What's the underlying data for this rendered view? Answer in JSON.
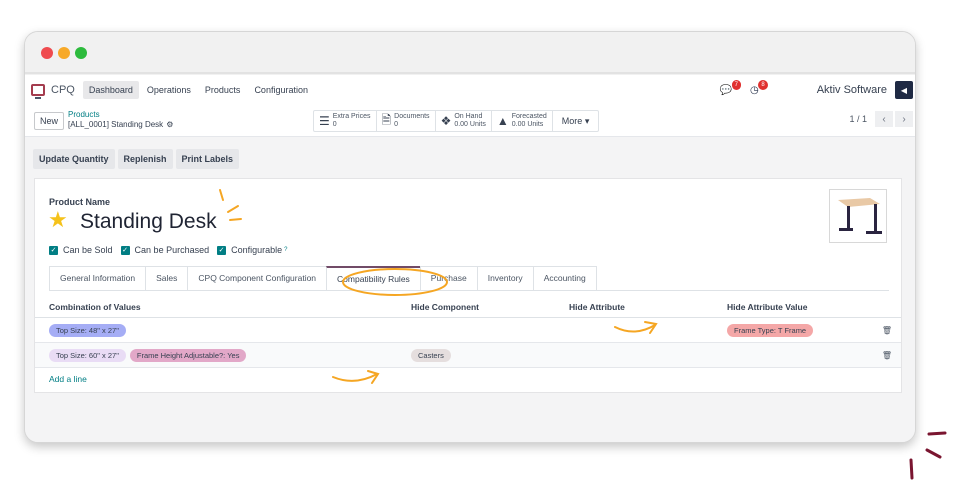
{
  "window": {
    "controls": [
      "close",
      "minimize",
      "maximize"
    ]
  },
  "navbar": {
    "app_name": "CPQ",
    "menu": [
      {
        "label": "Dashboard",
        "active": true
      },
      {
        "label": "Operations",
        "active": false
      },
      {
        "label": "Products",
        "active": false
      },
      {
        "label": "Configuration",
        "active": false
      }
    ],
    "messages_badge": "7",
    "activities_badge": "8",
    "company": "Aktiv Software",
    "avatar_icon": "exit-icon"
  },
  "control": {
    "new_label": "New",
    "breadcrumb_parent": "Products",
    "breadcrumb_current": "[ALL_0001] Standing Desk",
    "smart_buttons": [
      {
        "icon": "list-icon",
        "title": "Extra Prices",
        "value": "0"
      },
      {
        "icon": "document-icon",
        "title": "Documents",
        "value": "0"
      },
      {
        "icon": "cubes-icon",
        "title": "On Hand",
        "value": "0.00 Units"
      },
      {
        "icon": "area-chart-icon",
        "title": "Forecasted",
        "value": "0.00 Units"
      }
    ],
    "more_label": "More",
    "pager": "1 / 1"
  },
  "actions": [
    "Update Quantity",
    "Replenish",
    "Print Labels"
  ],
  "product": {
    "name_label": "Product Name",
    "name": "Standing Desk",
    "favorite": true,
    "checks": [
      {
        "label": "Can be Sold",
        "checked": true
      },
      {
        "label": "Can be Purchased",
        "checked": true
      },
      {
        "label": "Configurable",
        "checked": true,
        "help": "?"
      }
    ]
  },
  "tabs": [
    {
      "label": "General Information",
      "active": false
    },
    {
      "label": "Sales",
      "active": false
    },
    {
      "label": "CPQ Component Configuration",
      "active": false
    },
    {
      "label": "Compatibility Rules",
      "active": true
    },
    {
      "label": "Purchase",
      "active": false
    },
    {
      "label": "Inventory",
      "active": false
    },
    {
      "label": "Accounting",
      "active": false
    }
  ],
  "table": {
    "headers": [
      "Combination of Values",
      "Hide Component",
      "Hide Attribute",
      "Hide Attribute Value"
    ],
    "rows": [
      {
        "combination": [
          {
            "label": "Top Size: 48\" x 27\"",
            "color": "#a5adf5"
          }
        ],
        "hide_component": "",
        "hide_attribute": "",
        "hide_attribute_value": [
          {
            "label": "Frame Type: T Frame",
            "color": "#f4a7a7"
          }
        ]
      },
      {
        "combination": [
          {
            "label": "Top Size: 60\" x 27\"",
            "color": "#e9dcf5"
          },
          {
            "label": "Frame Height Adjustable?: Yes",
            "color": "#e2a8c8"
          }
        ],
        "hide_component": "Casters",
        "hide_attribute": "",
        "hide_attribute_value": []
      }
    ],
    "add_line": "Add a line"
  },
  "colors": {
    "accent": "#017e84",
    "brand": "#714b67",
    "annotation": "#f5a623",
    "sparkle": "#7a1530"
  }
}
